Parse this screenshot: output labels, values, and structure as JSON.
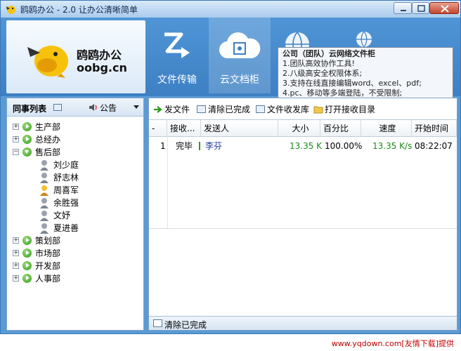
{
  "window": {
    "title": "鸥鸥办公 - 2.0 让办公清晰简单"
  },
  "logo": {
    "name_cn": "鸥鸥办公",
    "name_en": "oobg.cn"
  },
  "nav": [
    {
      "label": "文件传输",
      "icon": "file-transfer-icon"
    },
    {
      "label": "云文档柜",
      "icon": "cloud-cabinet-icon"
    },
    {
      "label": "",
      "icon": "globe-icon"
    },
    {
      "label": "",
      "icon": "globe-small-icon"
    }
  ],
  "tooltip": {
    "title": "公司（团队）云网络文件柜",
    "lines": [
      "1.团队高效协作工具!",
      "2.八级高安全权限体系;",
      "3.支持在线直接编辑word、excel、pdf;",
      "4.pc、移动等多端登陆，不受限制;"
    ]
  },
  "left": {
    "title": "同事列表",
    "notice": "公告",
    "groups": [
      {
        "label": "生产部",
        "expanded": false
      },
      {
        "label": "总经办",
        "expanded": false
      },
      {
        "label": "售后部",
        "expanded": true,
        "members": [
          "刘少庭",
          "舒志林",
          "周喜军",
          "余胜强",
          "文妤",
          "夏进善"
        ]
      },
      {
        "label": "策划部",
        "expanded": false
      },
      {
        "label": "市场部",
        "expanded": false
      },
      {
        "label": "开发部",
        "expanded": false
      },
      {
        "label": "人事部",
        "expanded": false
      }
    ]
  },
  "toolbar": {
    "send": "发文件",
    "clear_done": "清除已完成",
    "inbox": "文件收发库",
    "open_dir": "打开接收目录"
  },
  "grid": {
    "headers": [
      "-",
      "接收...",
      "发送人",
      "大小",
      "百分比",
      "速度",
      "开始时间"
    ],
    "rows": [
      {
        "idx": "1",
        "status": "完毕",
        "sender": "李芬",
        "size": "13.35 K",
        "percent": "100.00%",
        "speed": "13.35 K/s",
        "start": "08:22:07"
      }
    ]
  },
  "bottom": {
    "clear_done": "清除已完成"
  },
  "footer": {
    "text": "www.yqdown.com[友情下载]提供"
  },
  "colors": {
    "accent": "#4f95d6",
    "status_green": "#1a8a1a",
    "sender_blue": "#1b3a9c",
    "footer_red": "#c00000"
  }
}
